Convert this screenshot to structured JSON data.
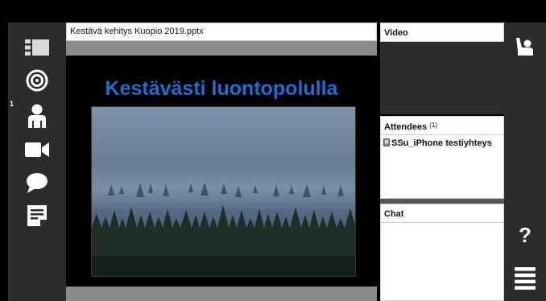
{
  "presentation": {
    "filename": "Kestävä kehitys Kuopio 2019.pptx",
    "slide_heading": "Kestävästi luontopolulla",
    "slide_image": "misty-forest-photo"
  },
  "left_toolbar": {
    "items": [
      {
        "icon": "layout-icon"
      },
      {
        "icon": "target-icon"
      },
      {
        "icon": "attendees-icon",
        "badge": "1"
      },
      {
        "icon": "video-camera-icon"
      },
      {
        "icon": "chat-bubble-icon"
      },
      {
        "icon": "notes-icon"
      }
    ]
  },
  "panels": {
    "video": {
      "title": "Video"
    },
    "attendees": {
      "title": "Attendees",
      "count": "(1)",
      "list": [
        {
          "name": "SSu_iPhone testiyhteys",
          "device_icon": "phone-icon"
        }
      ]
    },
    "chat": {
      "title": "Chat"
    }
  },
  "right_toolbar": {
    "items": [
      {
        "icon": "raise-hand-icon"
      },
      {
        "icon": "help-icon",
        "label": "?"
      },
      {
        "icon": "menu-icon"
      }
    ]
  },
  "colors": {
    "rail": "#2c2c2c",
    "slide_heading": "#1f6fd1",
    "slide_frame": "#8a8a8a"
  }
}
